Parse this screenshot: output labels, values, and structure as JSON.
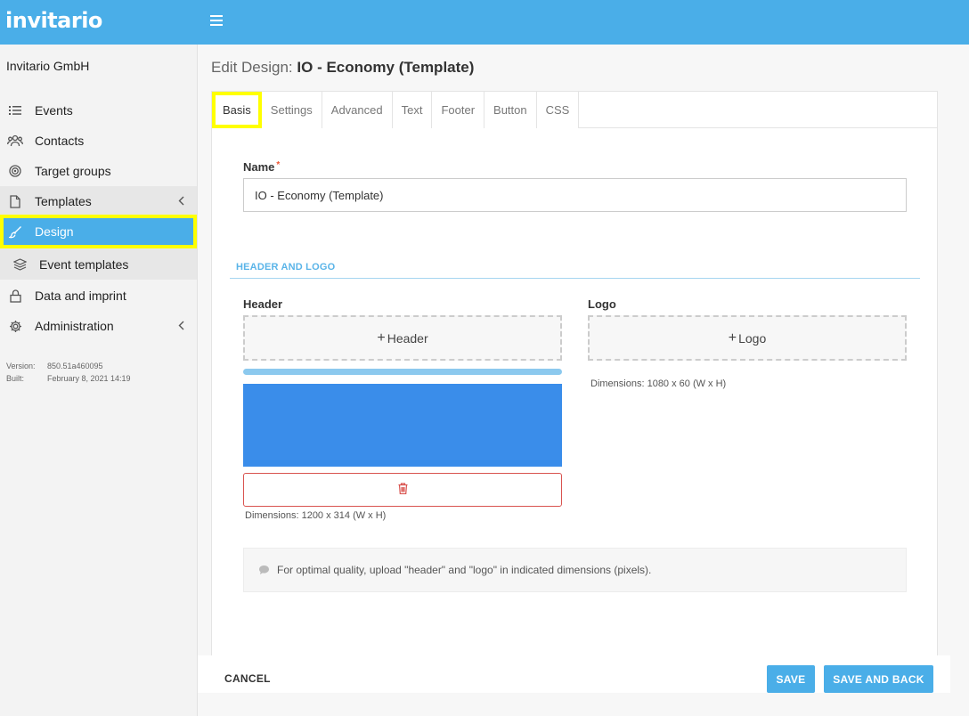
{
  "brand": {
    "logo_text": "invitario",
    "accent": "#4aaee8",
    "highlight": "#ffff00"
  },
  "sidebar": {
    "org_name": "Invitario GmbH",
    "items": [
      {
        "label": "Events",
        "icon": "list-icon"
      },
      {
        "label": "Contacts",
        "icon": "users-icon"
      },
      {
        "label": "Target groups",
        "icon": "target-icon"
      },
      {
        "label": "Templates",
        "icon": "file-icon"
      },
      {
        "label": "Design",
        "icon": "brush-icon"
      },
      {
        "label": "Event templates",
        "icon": "layers-icon"
      },
      {
        "label": "Data and imprint",
        "icon": "lock-icon"
      },
      {
        "label": "Administration",
        "icon": "gear-icon"
      }
    ],
    "version_label": "Version:",
    "version_value": "850.51a460095",
    "built_label": "Built:",
    "built_value": "February 8, 2021 14:19"
  },
  "page": {
    "title_prefix": "Edit Design:",
    "title_name": "IO - Economy (Template)"
  },
  "tabs": [
    "Basis",
    "Settings",
    "Advanced",
    "Text",
    "Footer",
    "Button",
    "CSS"
  ],
  "form": {
    "name_label": "Name",
    "required_mark": "*",
    "name_value": "IO - Economy (Template)",
    "section_title": "HEADER AND LOGO",
    "header_label": "Header",
    "header_button": "Header",
    "header_dimensions": "Dimensions: 1200 x 314 (W x H)",
    "header_preview_color": "#3a8dea",
    "logo_label": "Logo",
    "logo_button": "Logo",
    "logo_dimensions": "Dimensions: 1080 x 60 (W x H)",
    "info_text": "For optimal quality, upload \"header\" and \"logo\" in indicated dimensions (pixels)."
  },
  "actions": {
    "cancel": "CANCEL",
    "save": "SAVE",
    "save_and_back": "SAVE AND BACK"
  }
}
